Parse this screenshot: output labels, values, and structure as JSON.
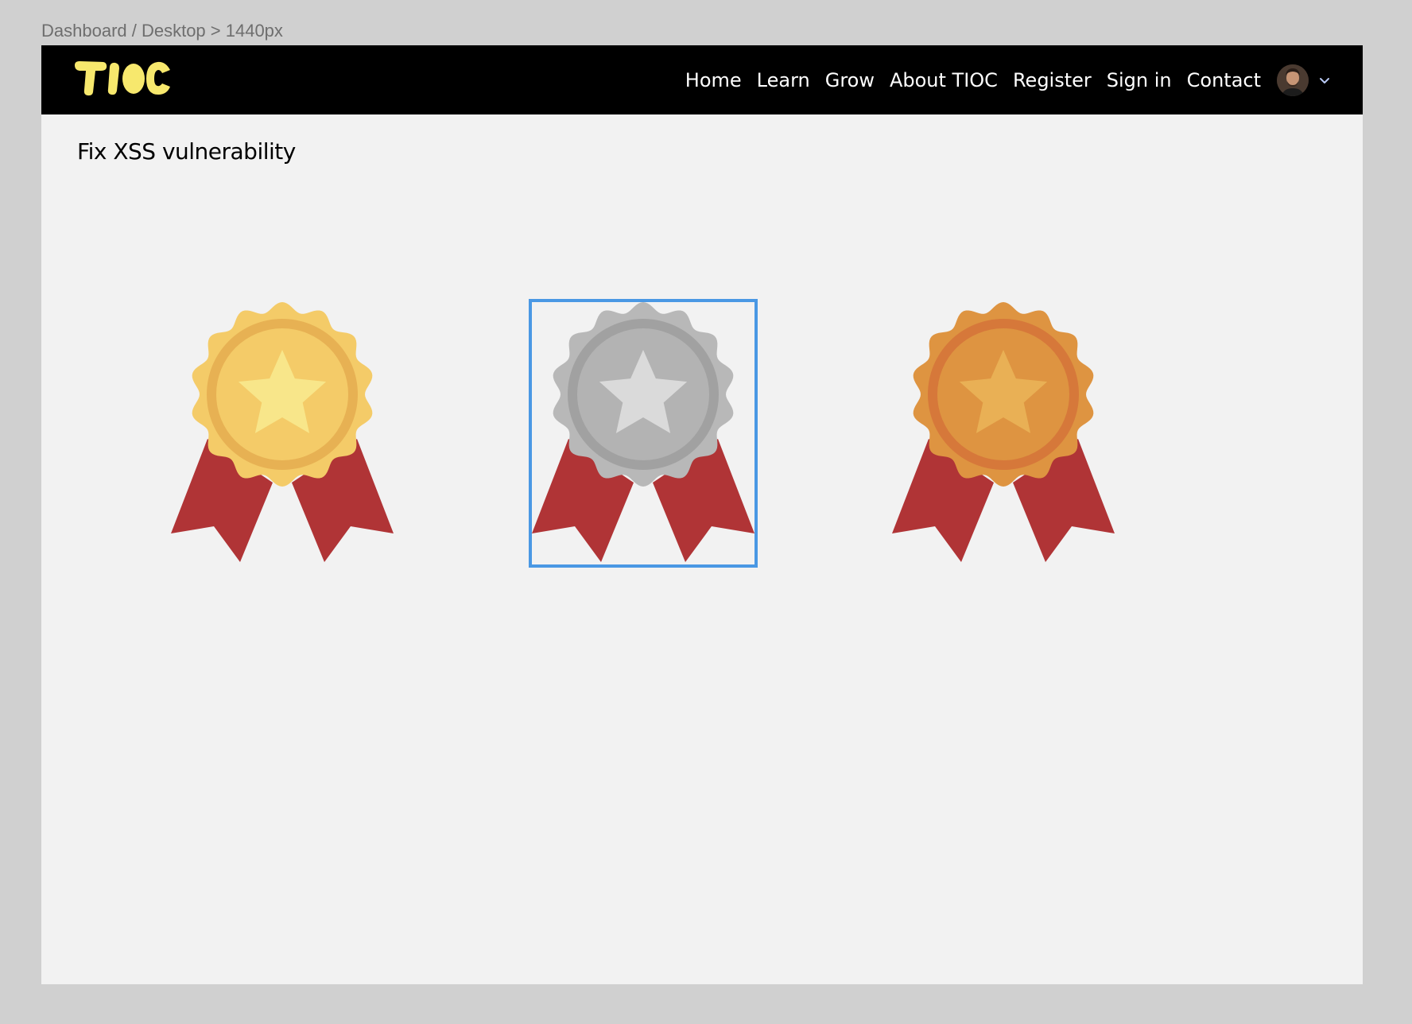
{
  "breadcrumb": "Dashboard / Desktop > 1440px",
  "brand": {
    "logo_text": "TIOC",
    "logo_color": "#f7e86d"
  },
  "nav": {
    "links": [
      "Home",
      "Learn",
      "Grow",
      "About TIOC",
      "Register",
      "Sign in",
      "Contact"
    ],
    "avatar_icon": "user-avatar",
    "dropdown_icon": "chevron-down-icon"
  },
  "page": {
    "title": "Fix XSS vulnerability"
  },
  "medals": [
    {
      "name": "gold-medal",
      "outer": "#f4cb68",
      "ring": "#e7b153",
      "inner": "#f4cb68",
      "star": "#f8e68a",
      "selected": false
    },
    {
      "name": "silver-medal",
      "outer": "#b8b8b8",
      "ring": "#a1a1a1",
      "inner": "#b3b3b3",
      "star": "#dadada",
      "selected": true
    },
    {
      "name": "bronze-medal",
      "outer": "#de9441",
      "ring": "#d6783a",
      "inner": "#de9441",
      "star": "#e9b055",
      "selected": false
    }
  ],
  "colors": {
    "ribbon": "#b03436",
    "selection": "#4a98e4",
    "navbar": "#000000",
    "canvas": "#f2f2f2"
  }
}
